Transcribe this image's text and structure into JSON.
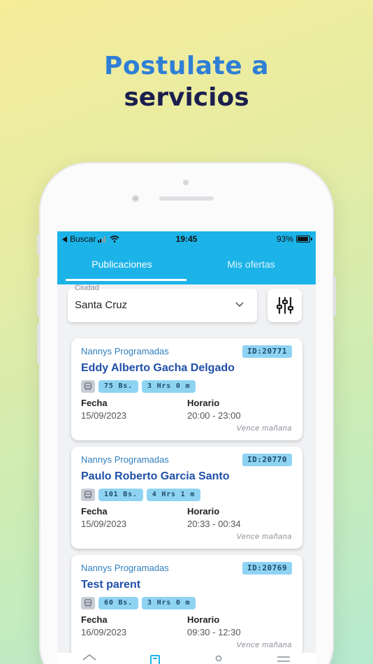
{
  "headline": {
    "line1": "Postulate a",
    "line2": "servicios"
  },
  "status": {
    "back": "Buscar",
    "time": "19:45",
    "battery": "93%"
  },
  "tabs": [
    {
      "label": "Publicaciones",
      "active": true
    },
    {
      "label": "Mis ofertas",
      "active": false
    }
  ],
  "filter": {
    "label": "Ciudad",
    "value": "Santa Cruz"
  },
  "cards": [
    {
      "service": "Nannys Programadas",
      "id": "ID:20771",
      "name": "Eddy Alberto  Gacha Delgado",
      "price": "75 Bs.",
      "duration": "3 Hrs 0 m",
      "fecha_label": "Fecha",
      "fecha": "15/09/2023",
      "horario_label": "Horario",
      "horario": "20:00 - 23:00",
      "expire": "Vence mañana"
    },
    {
      "service": "Nannys Programadas",
      "id": "ID:20770",
      "name": "Paulo Roberto  Garcia Santo",
      "price": "101 Bs.",
      "duration": "4 Hrs 1 m",
      "fecha_label": "Fecha",
      "fecha": "15/09/2023",
      "horario_label": "Horario",
      "horario": "20:33 - 00:34",
      "expire": "Vence mañana"
    },
    {
      "service": "Nannys Programadas",
      "id": "ID:20769",
      "name": "Test parent",
      "price": "60 Bs.",
      "duration": "3 Hrs 0 m",
      "fecha_label": "Fecha",
      "fecha": "16/09/2023",
      "horario_label": "Horario",
      "horario": "09:30 - 12:30",
      "expire": "Vence mañana"
    }
  ],
  "colors": {
    "appbar": "#1cb3e8",
    "badge": "#8fd3f3",
    "name": "#1f4fa8",
    "headline_accent": "#2f7fd6",
    "headline_dark": "#1b1f4e"
  }
}
